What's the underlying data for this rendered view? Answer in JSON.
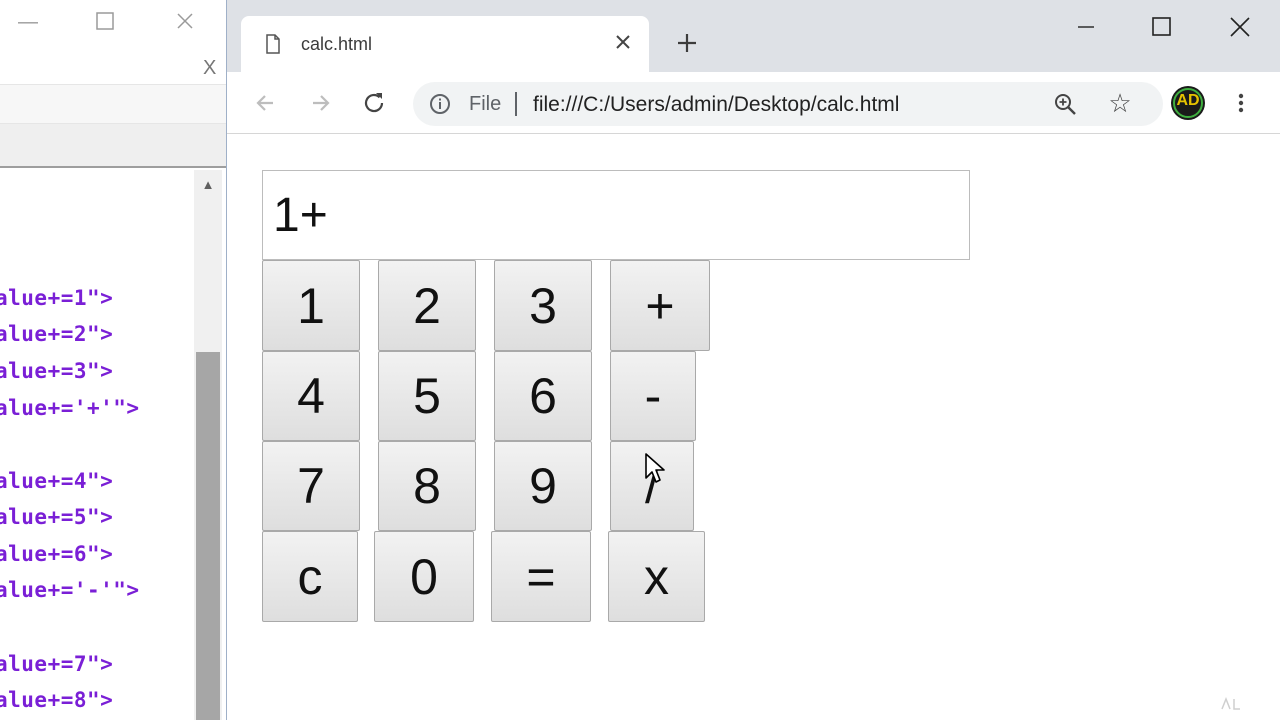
{
  "editor": {
    "close_label": "X",
    "code_lines": [
      "alue+=1\">",
      "alue+=2\">",
      "alue+=3\">",
      "alue+='+'\">",
      "alue+=4\">",
      "alue+=5\">",
      "alue+=6\">",
      "alue+='-'\">",
      "alue+=7\">",
      "alue+=8\">"
    ]
  },
  "browser": {
    "tab_title": "calc.html",
    "omnibox": {
      "scheme_label": "File",
      "url": "file:///C:/Users/admin/Desktop/calc.html"
    },
    "avatar_initials": "AD"
  },
  "calculator": {
    "display_value": "1+",
    "keys": [
      "1",
      "2",
      "3",
      "+",
      "4",
      "5",
      "6",
      "-",
      "7",
      "8",
      "9",
      "/",
      "c",
      "0",
      "=",
      "x"
    ]
  },
  "colors": {
    "code_text": "#7a1fd6",
    "tabstrip_bg": "#dee1e6",
    "key_border": "#a9a9a9"
  }
}
